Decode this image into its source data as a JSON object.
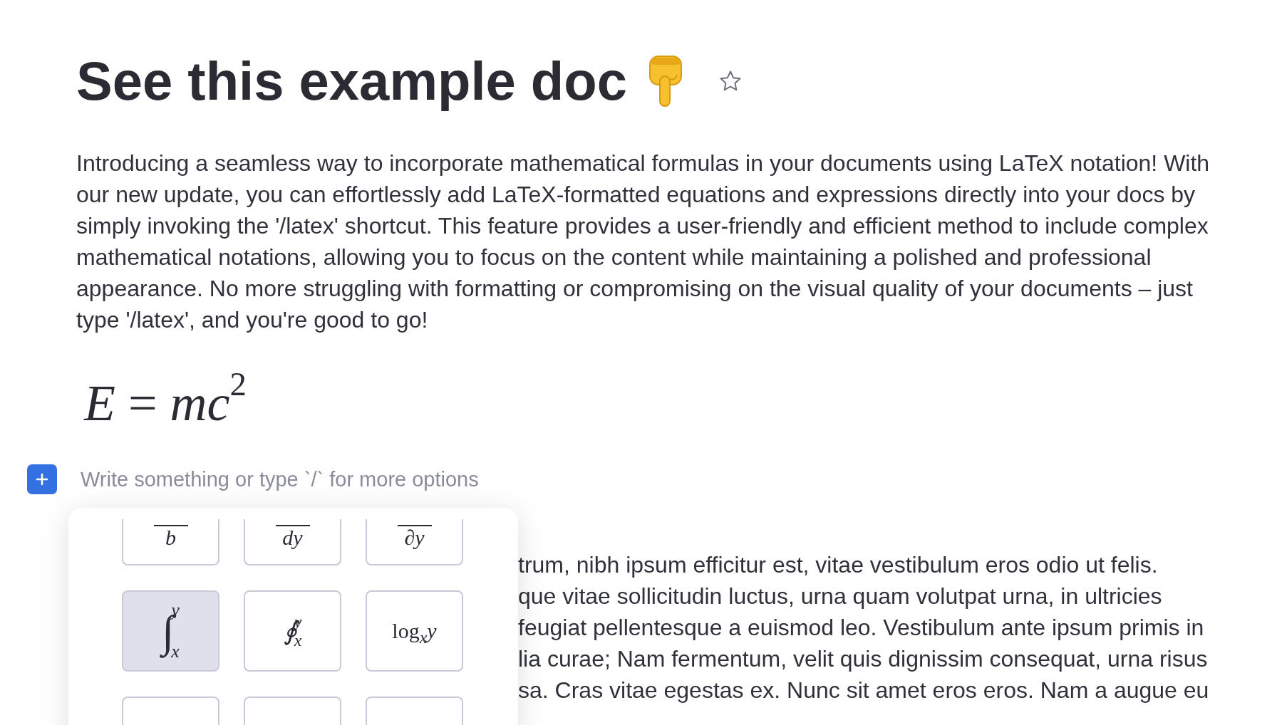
{
  "title": "See this example doc",
  "starred": false,
  "intro": "Introducing a seamless way to incorporate mathematical formulas in your documents using LaTeX notation! With our new update, you can effortlessly add LaTeX-formatted equations and expressions directly into your docs by simply invoking the '/latex' shortcut. This feature provides a user-friendly and efficient method to include complex mathematical notations, allowing you to focus on the content while maintaining a polished and professional appearance. No more struggling with formatting or compromising on the visual quality of your documents – just type '/latex', and you're good to go!",
  "formula": "*E* = *mc*$^{2}$",
  "editor": {
    "placeholder": "Write something or type `/` for more options"
  },
  "picker": {
    "tiles": [
      {
        "kind": "fraction",
        "denominator": "b",
        "selected": false
      },
      {
        "kind": "fraction",
        "denominator": "dy",
        "selected": false
      },
      {
        "kind": "fraction",
        "denominator": "∂y",
        "selected": false
      },
      {
        "kind": "integral",
        "symbol": "∫",
        "upper": "y",
        "lower": "x",
        "selected": true
      },
      {
        "kind": "integral",
        "symbol": "∮",
        "upper": "y",
        "lower": "x",
        "selected": false
      },
      {
        "kind": "log",
        "name": "log",
        "base": "x",
        "argument": "y",
        "selected": false
      },
      {
        "kind": "blank",
        "selected": false
      },
      {
        "kind": "blank",
        "selected": false
      },
      {
        "kind": "blank",
        "selected": false
      }
    ]
  },
  "body_lines": [
    "trum, nibh ipsum efficitur est, vitae vestibulum eros odio ut felis.",
    "que vitae sollicitudin luctus, urna quam volutpat urna, in ultricies",
    "feugiat pellentesque a euismod leo. Vestibulum ante ipsum primis in",
    "lia curae; Nam fermentum, velit quis dignissim consequat, urna risus",
    "sa. Cras vitae egestas ex. Nunc sit amet eros eros. Nam a augue eu"
  ]
}
